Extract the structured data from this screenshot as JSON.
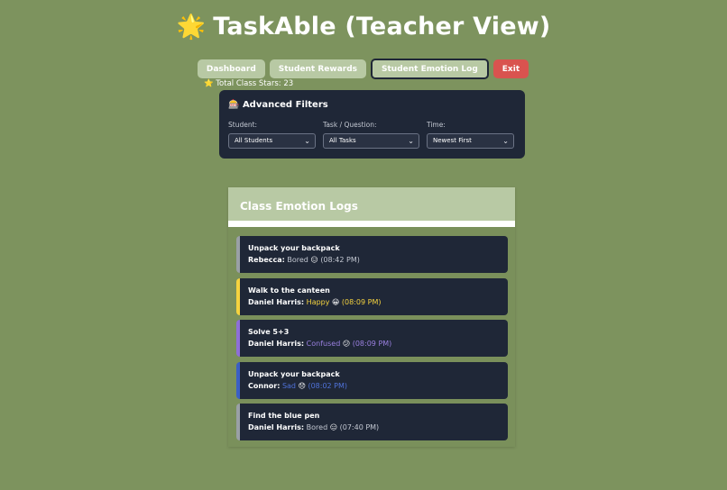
{
  "app": {
    "title": "TaskAble (Teacher View)",
    "title_icon": "🌟"
  },
  "nav": {
    "dashboard": "Dashboard",
    "rewards": "Student Rewards",
    "emotion_log": "Student Emotion Log",
    "exit": "Exit"
  },
  "stars": {
    "icon": "⭐",
    "text": "Total Class Stars: 23"
  },
  "filters": {
    "icon": "🎰",
    "title": "Advanced Filters",
    "student_label": "Student:",
    "student_value": "All Students",
    "task_label": "Task / Question:",
    "task_value": "All Tasks",
    "time_label": "Time:",
    "time_value": "Newest First"
  },
  "logs_panel": {
    "title": "Class Emotion Logs",
    "items": [
      {
        "task": "Unpack your backpack",
        "student": "Rebecca:",
        "emotion": "Bored",
        "emoji": "😑",
        "time": "(08:42 PM)",
        "color": "#9aa0a6",
        "text_color": "#c3c8d2"
      },
      {
        "task": "Walk to the canteen",
        "student": "Daniel Harris:",
        "emotion": "Happy",
        "emoji": "😀",
        "time": "(08:09 PM)",
        "color": "#f5d33f",
        "text_color": "#f5d33f"
      },
      {
        "task": "Solve 5+3",
        "student": "Daniel Harris:",
        "emotion": "Confused",
        "emoji": "😕",
        "time": "(08:09 PM)",
        "color": "#8e6fd8",
        "text_color": "#9a80e0"
      },
      {
        "task": "Unpack your backpack",
        "student": "Connor:",
        "emotion": "Sad",
        "emoji": "😞",
        "time": "(08:02 PM)",
        "color": "#3b5fc4",
        "text_color": "#4f72d9"
      },
      {
        "task": "Find the blue pen",
        "student": "Daniel Harris:",
        "emotion": "Bored",
        "emoji": "😑",
        "time": "(07:40 PM)",
        "color": "#9aa0a6",
        "text_color": "#c3c8d2"
      }
    ]
  }
}
